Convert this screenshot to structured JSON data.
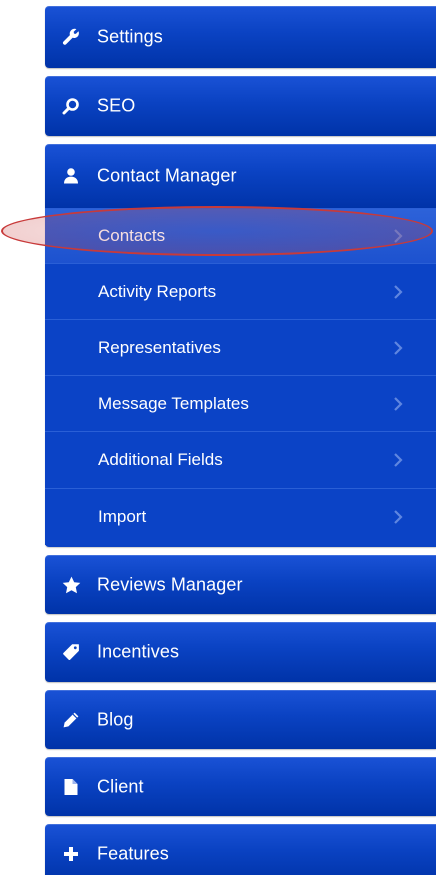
{
  "sidebar": {
    "items": [
      {
        "label": "Settings",
        "icon": "wrench-icon"
      },
      {
        "label": "SEO",
        "icon": "search-icon"
      },
      {
        "label": "Contact Manager",
        "icon": "user-icon"
      },
      {
        "label": "Reviews Manager",
        "icon": "star-icon"
      },
      {
        "label": "Incentives",
        "icon": "tag-icon"
      },
      {
        "label": "Blog",
        "icon": "pencil-icon"
      },
      {
        "label": "Client",
        "icon": "file-icon"
      },
      {
        "label": "Features",
        "icon": "plus-icon"
      }
    ],
    "contact_manager_submenu": [
      {
        "label": "Contacts",
        "active": true
      },
      {
        "label": "Activity Reports"
      },
      {
        "label": "Representatives"
      },
      {
        "label": "Message Templates"
      },
      {
        "label": "Additional Fields"
      },
      {
        "label": "Import"
      }
    ]
  },
  "colors": {
    "menu_blue": "#0a42c2",
    "highlight_red": "#c83a3a",
    "text": "#ffffff"
  }
}
